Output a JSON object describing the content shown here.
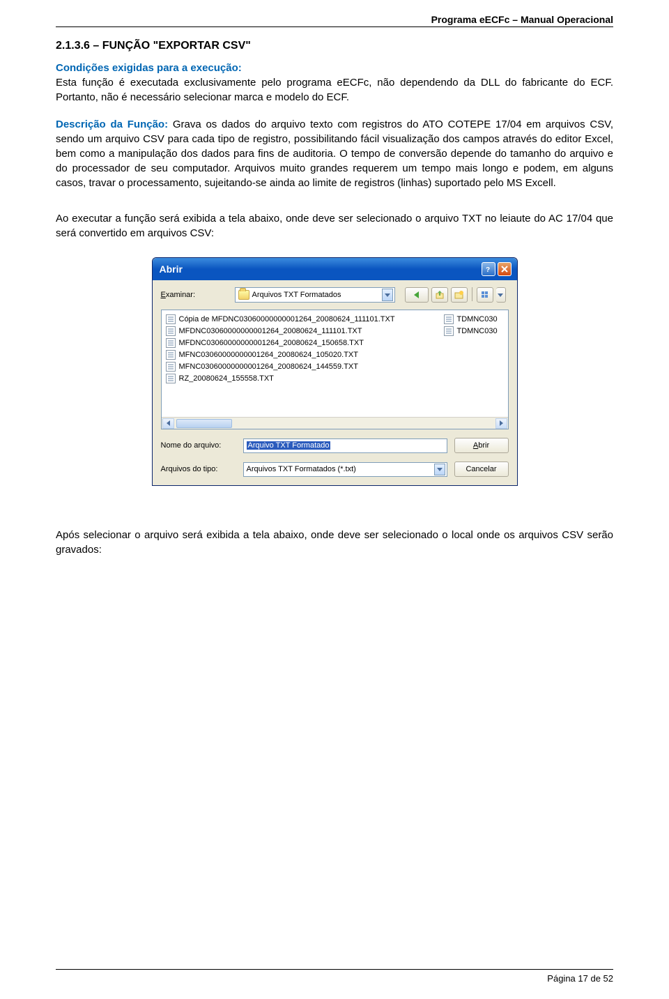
{
  "header": {
    "doc_title": "Programa eECFc – Manual Operacional"
  },
  "section": {
    "number_title": "2.1.3.6 – FUNÇÃO \"EXPORTAR CSV\"",
    "cond_label": "Condições exigidas para a execução:",
    "cond_text": "Esta função é executada exclusivamente pelo programa eECFc, não dependendo da DLL do fabricante do ECF. Portanto, não é necessário selecionar marca e modelo do ECF.",
    "desc_label": "Descrição da Função:",
    "desc_text": " Grava os dados do arquivo texto com registros do ATO COTEPE 17/04 em arquivos CSV, sendo um arquivo CSV para cada tipo de registro, possibilitando fácil visualização dos campos através do editor Excel, bem como a manipulação dos dados para fins de auditoria. O tempo de conversão depende do tamanho do arquivo e do processador de seu computador. Arquivos muito grandes requerem um tempo mais longo e podem, em alguns casos, travar o processamento, sujeitando-se ainda ao limite de registros (linhas) suportado pelo MS Excell.",
    "exec_text": "Ao executar a função será exibida a tela abaixo, onde deve ser selecionado o arquivo TXT no leiaute do AC 17/04 que será convertido em arquivos CSV:",
    "after_text": "Após selecionar o arquivo será exibida a tela abaixo, onde deve ser selecionado o local onde os arquivos CSV serão gravados:"
  },
  "dialog": {
    "title": "Abrir",
    "examine_label": "Examinar:",
    "examine_u": "E",
    "folder_name": "Arquivos TXT Formatados",
    "files_col1": [
      "Cópia de MFDNC03060000000001264_20080624_111101.TXT",
      "MFDNC03060000000001264_20080624_111101.TXT",
      "MFDNC03060000000001264_20080624_150658.TXT",
      "MFNC03060000000001264_20080624_105020.TXT",
      "MFNC03060000000001264_20080624_144559.TXT",
      "RZ_20080624_155558.TXT"
    ],
    "files_col2": [
      "TDMNC030",
      "TDMNC030"
    ],
    "filename_label": "Nome do arquivo:",
    "filename_u": "N",
    "filename_value": "Arquivo TXT Formatado",
    "filetype_label": "Arquivos do tipo:",
    "filetype_u": "t",
    "filetype_value": "Arquivos TXT Formatados (*.txt)",
    "open_btn": "Abrir",
    "open_u": "A",
    "cancel_btn": "Cancelar"
  },
  "footer": {
    "page": "Página 17 de 52"
  }
}
